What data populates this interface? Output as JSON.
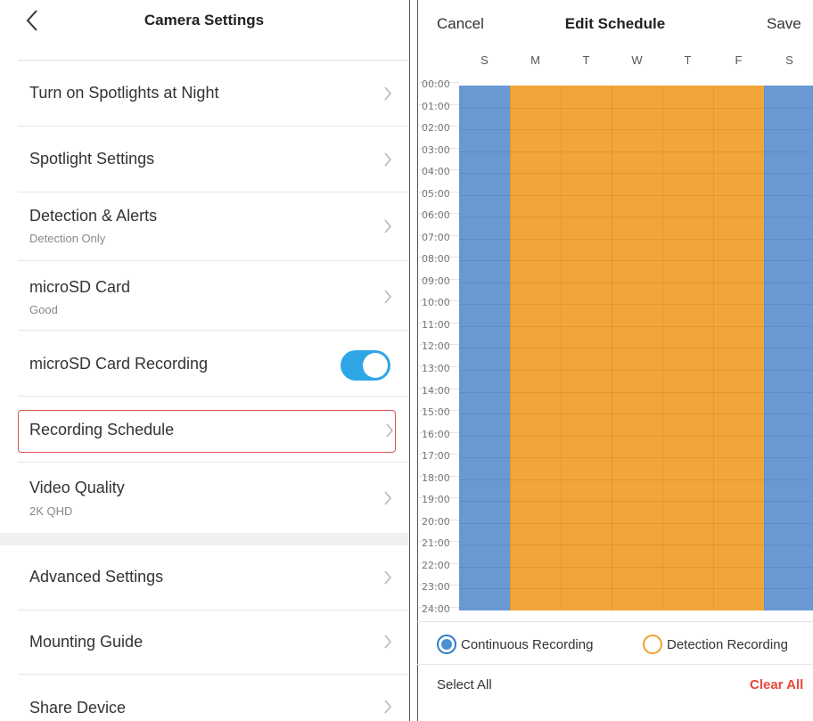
{
  "left": {
    "title": "Camera Settings",
    "rows": [
      {
        "label": "Turn on Spotlights at Night",
        "sub": ""
      },
      {
        "label": "Spotlight Settings",
        "sub": ""
      },
      {
        "label": "Detection & Alerts",
        "sub": "Detection Only"
      },
      {
        "label": "microSD Card",
        "sub": "Good"
      },
      {
        "label": "microSD Card Recording",
        "sub": "",
        "toggle_on": true
      },
      {
        "label": "Recording Schedule",
        "sub": ""
      },
      {
        "label": "Video Quality",
        "sub": "2K QHD"
      },
      {
        "label": "Advanced Settings",
        "sub": ""
      },
      {
        "label": "Mounting Guide",
        "sub": ""
      },
      {
        "label": "Share Device",
        "sub": ""
      }
    ]
  },
  "right": {
    "cancel": "Cancel",
    "title": "Edit Schedule",
    "save": "Save",
    "days": [
      "S",
      "M",
      "T",
      "W",
      "T",
      "F",
      "S"
    ],
    "hours": [
      "00:00",
      "01:00",
      "02:00",
      "03:00",
      "04:00",
      "05:00",
      "06:00",
      "07:00",
      "08:00",
      "09:00",
      "10:00",
      "11:00",
      "12:00",
      "13:00",
      "14:00",
      "15:00",
      "16:00",
      "17:00",
      "18:00",
      "19:00",
      "20:00",
      "21:00",
      "22:00",
      "23:00",
      "24:00"
    ],
    "schedule": [
      "continuous",
      "detection",
      "detection",
      "detection",
      "detection",
      "detection",
      "continuous"
    ],
    "legend": {
      "continuous": "Continuous Recording",
      "detection": "Detection Recording"
    },
    "select_all": "Select All",
    "clear_all": "Clear All"
  },
  "colors": {
    "continuous": "#6a98d3",
    "detection": "#f2a53a",
    "toggle": "#2ea6e6",
    "clear_all": "#e8473b",
    "highlight": "#d9534f"
  }
}
